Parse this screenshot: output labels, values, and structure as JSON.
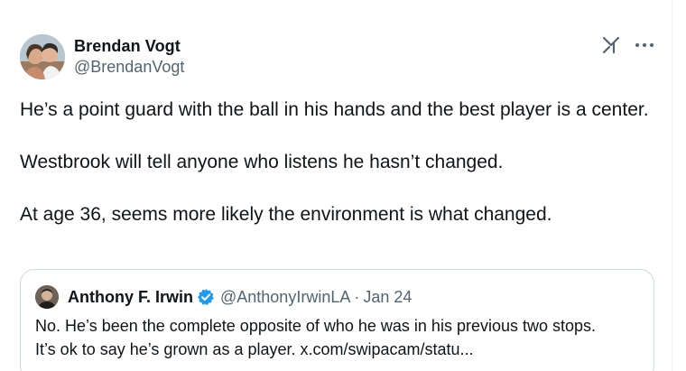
{
  "tweet": {
    "author": {
      "name": "Brendan Vogt",
      "handle": "@BrendanVogt",
      "avatar_icon": "avatar-photo-icon"
    },
    "actions": {
      "grok_icon": "grok-icon",
      "more_icon": "more-icon"
    },
    "body": {
      "p1": "He’s a point guard with the ball in his hands and the best player is a center.",
      "p2": "Westbrook will tell anyone who listens he hasn’t changed.",
      "p3": "At age 36, seems more likely the environment is what changed."
    },
    "quote": {
      "name": "Anthony F. Irwin",
      "verified": true,
      "handle": "@AnthonyIrwinLA",
      "separator": "·",
      "date": "Jan 24",
      "line1": "No. He’s been the complete opposite of who he was in his previous two stops.",
      "line2": "It’s ok to say he’s grown as a player. x.com/swipacam/statu..."
    }
  },
  "colors": {
    "text_primary": "#0f1419",
    "text_secondary": "#536471",
    "border": "#cfd9de",
    "verified": "#1d9bf0"
  }
}
